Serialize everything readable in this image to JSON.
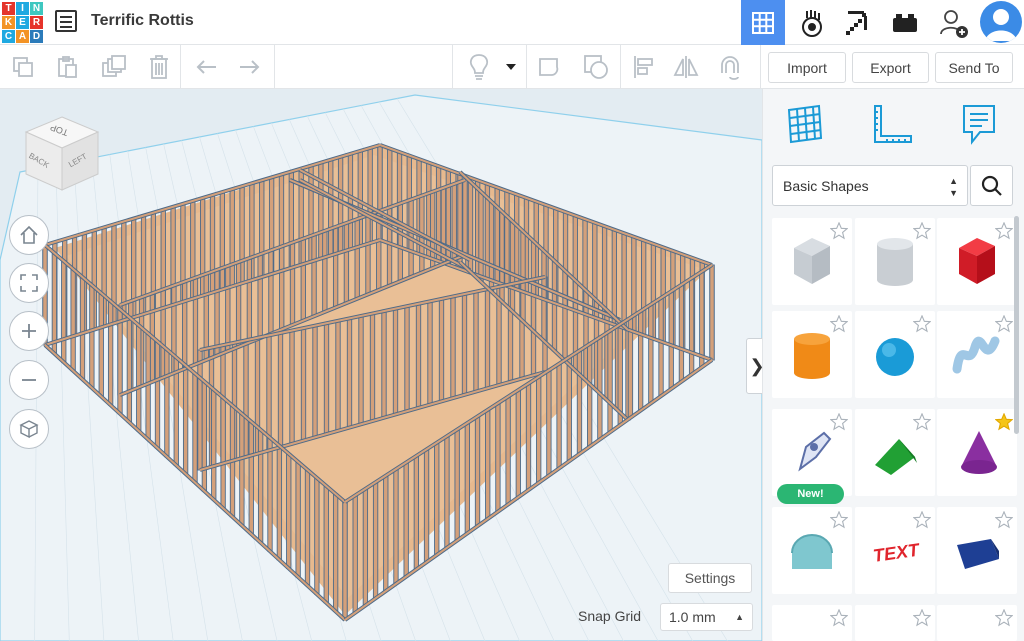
{
  "app": {
    "logo_letters": [
      "T",
      "I",
      "N",
      "K",
      "E",
      "R",
      "C",
      "A",
      "D"
    ],
    "logo_colors": [
      "#e4352b",
      "#1fa9e1",
      "#3ec7c0",
      "#f39325",
      "#d9d9d9",
      "#e6332a",
      "#1fa9e1",
      "#f39325",
      "#2b7bba"
    ],
    "project_title": "Terrific Rottis"
  },
  "topnav": {
    "items": [
      {
        "name": "3d-design-view-icon",
        "active": true
      },
      {
        "name": "circuits-icon",
        "active": false
      },
      {
        "name": "minecraft-pickaxe-icon",
        "active": false
      },
      {
        "name": "bricks-icon",
        "active": false
      },
      {
        "name": "add-user-icon",
        "active": false
      }
    ]
  },
  "toolbar": {
    "import_label": "Import",
    "export_label": "Export",
    "send_to_label": "Send To"
  },
  "viewcube": {
    "top": "TOP",
    "back": "BACK",
    "left": "LEFT"
  },
  "panel": {
    "shape_category": "Basic Shapes",
    "new_badge": "New!",
    "tile_shapes": [
      "box",
      "cylinder-hole",
      "box-red",
      "cylinder-orange",
      "sphere",
      "scribble",
      "paint-pen",
      "roof",
      "cone",
      "half-round",
      "text",
      "wedge-navy"
    ]
  },
  "workplane": {
    "settings_label": "Settings",
    "snap_grid_label": "Snap Grid",
    "snap_grid_value": "1.0 mm"
  },
  "colors": {
    "accent": "#4d8ff0",
    "stud_fill": "#d4a07a",
    "stud_edge": "#4e6b89",
    "floor": "#e7b98e",
    "new_badge": "#2bb673"
  }
}
